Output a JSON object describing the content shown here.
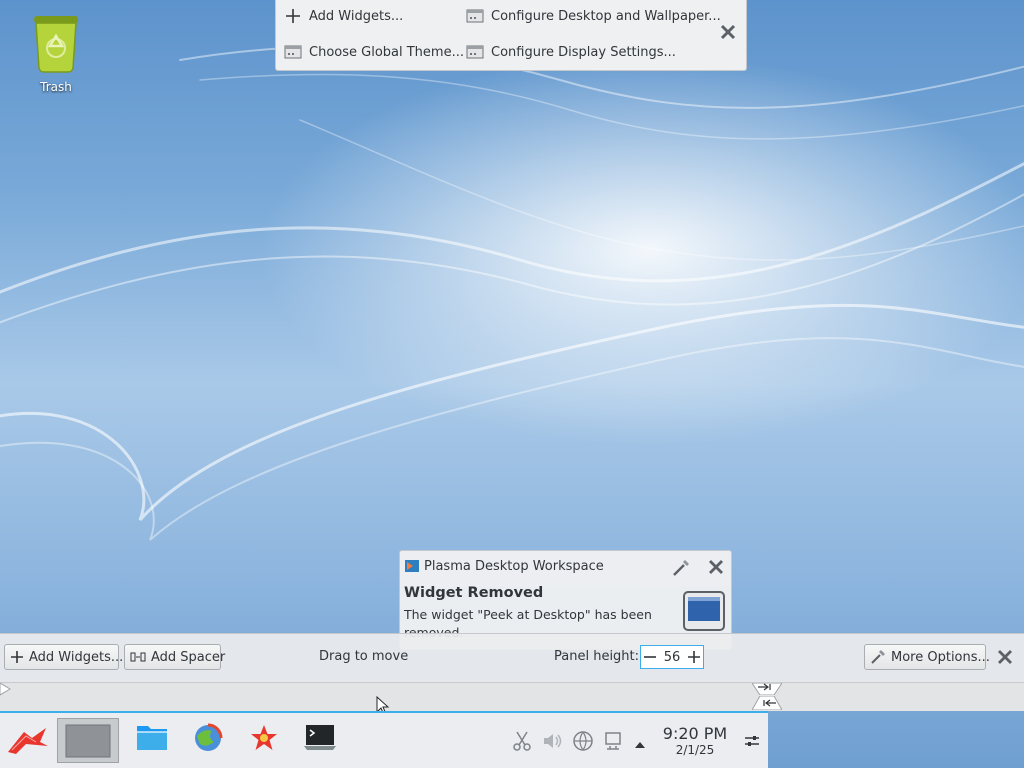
{
  "desktop": {
    "trash_label": "Trash"
  },
  "toolbox": {
    "add_widgets": "Add Widgets...",
    "configure_desktop": "Configure Desktop and Wallpaper...",
    "global_theme": "Choose Global Theme...",
    "display_settings": "Configure Display Settings..."
  },
  "notification": {
    "app_name": "Plasma Desktop Workspace",
    "title": "Widget Removed",
    "body": "The widget \"Peek at Desktop\" has been removed."
  },
  "panel_config": {
    "add_widgets": "Add Widgets...",
    "add_spacer": "Add Spacer",
    "drag_to_move": "Drag to move",
    "panel_height_label": "Panel height:",
    "panel_height_value": "56",
    "more_options": "More Options..."
  },
  "taskbar": {
    "time": "9:20 PM",
    "date": "2/1/25"
  },
  "icons": [
    "trash-icon",
    "plus-icon",
    "configure-icon",
    "theme-icon",
    "display-icon",
    "close-icon",
    "spacer-icon",
    "minus-icon",
    "wrench-icon",
    "application-launcher-icon",
    "file-manager-icon",
    "browser-icon",
    "app-icon",
    "terminal-icon",
    "clipboard-icon",
    "volume-icon",
    "network-icon",
    "device-notifier-icon",
    "expand-arrow-icon",
    "panel-settings-icon"
  ],
  "colors": {
    "accent": "#3daee9",
    "panel_bg": "#eff0f1",
    "text": "#31363b"
  }
}
